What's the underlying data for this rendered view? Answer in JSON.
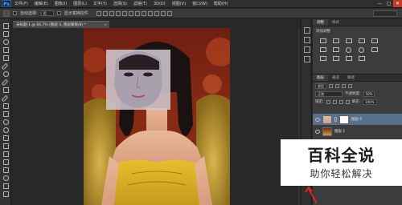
{
  "menubar": {
    "logo": "Ps",
    "items": [
      "文件(F)",
      "编辑(E)",
      "图像(I)",
      "图层(L)",
      "文字(Y)",
      "选择(S)",
      "滤镜(T)",
      "3D(D)",
      "视图(V)",
      "窗口(W)",
      "帮助(H)"
    ],
    "window_controls": [
      "—",
      "□",
      "✕"
    ]
  },
  "options": {
    "auto_select_label": "自动选择:",
    "auto_select_value": "组",
    "show_transform_label": "显示变换控件"
  },
  "document_tab": {
    "title": "未标题-1 @ 66.7% (图层 0, 图层蒙版/8) *",
    "close": "×"
  },
  "panels": {
    "top_tabs": [
      "调整",
      "样式"
    ],
    "adjust_header": "添加调整",
    "layer_tabs": [
      "图层",
      "通道",
      "路径"
    ],
    "filter_kind": "类型",
    "blend_mode": "正常",
    "opacity_label": "不透明度:",
    "opacity_value": "50%",
    "lock_label": "锁定:",
    "fill_label": "填充:",
    "fill_value": "100%",
    "layers": [
      {
        "name": "图层 0",
        "selected": true
      },
      {
        "name": "图层 1",
        "selected": false
      }
    ]
  },
  "watermark": {
    "brand": "百科全说",
    "slogan": "助你轻松解决"
  },
  "colors": {
    "ps_blue": "#4aa7ff",
    "close_red": "#c43a2b",
    "selected_layer": "#5a6f8e",
    "arrow_red": "#d8262b"
  }
}
